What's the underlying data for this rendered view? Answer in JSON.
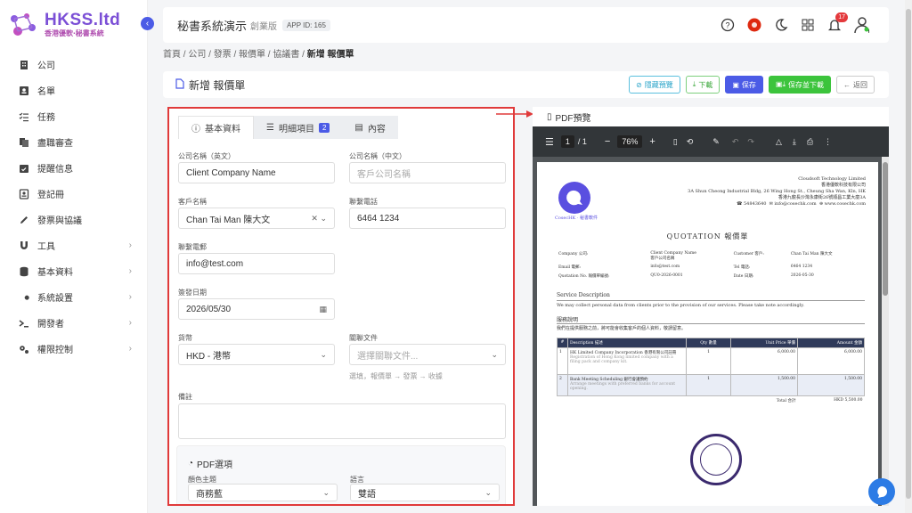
{
  "brand": {
    "title": "HKSS.ltd",
    "subtitle": "香港優軟‧秘書系統",
    "accent": "#7b4fd6"
  },
  "sidebar": {
    "items": [
      {
        "label": "公司",
        "icon": "building-icon"
      },
      {
        "label": "名單",
        "icon": "contact-card-icon"
      },
      {
        "label": "任務",
        "icon": "checklist-icon"
      },
      {
        "label": "盡職審查",
        "icon": "documents-icon"
      },
      {
        "label": "提醒信息",
        "icon": "calendar-check-icon"
      },
      {
        "label": "登記冊",
        "icon": "register-book-icon"
      },
      {
        "label": "發票與協議",
        "icon": "pen-icon"
      },
      {
        "label": "工具",
        "icon": "magnet-icon",
        "expandable": true
      },
      {
        "label": "基本資料",
        "icon": "database-icon",
        "expandable": true
      },
      {
        "label": "系統設置",
        "icon": "wrench-icon",
        "expandable": true
      },
      {
        "label": "開發者",
        "icon": "terminal-icon",
        "expandable": true
      },
      {
        "label": "權限控制",
        "icon": "gears-icon",
        "expandable": true
      }
    ]
  },
  "topbar": {
    "title": "秘書系統演示",
    "edition": "創業版",
    "app_id": "APP ID: 165",
    "notification_count": "17"
  },
  "breadcrumb": {
    "items": [
      "首頁",
      "公司",
      "發票 / 報價單 / 協議書"
    ],
    "current": "新增 報價單"
  },
  "page": {
    "title": "新增 報價單"
  },
  "actions": {
    "hide_preview": "隱藏預覽",
    "download": "下載",
    "save": "保存",
    "save_download": "保存並下載",
    "back": "返回"
  },
  "tabs": [
    {
      "label": "基本資料",
      "icon": "info-icon"
    },
    {
      "label": "明細項目",
      "icon": "list-icon",
      "count": "2"
    },
    {
      "label": "內容",
      "icon": "document-icon"
    }
  ],
  "form": {
    "company_en_label": "公司名稱（英文）",
    "company_en_value": "Client Company Name",
    "company_zh_label": "公司名稱（中文）",
    "company_zh_placeholder": "客戶公司名稱",
    "customer_label": "客戶名稱",
    "customer_value": "Chan Tai Man 陳大文",
    "phone_label": "聯繫電話",
    "phone_value": "6464 1234",
    "email_label": "聯繫電郵",
    "email_value": "info@test.com",
    "date_label": "簽發日期",
    "date_value": "2026/05/30",
    "currency_label": "貨幣",
    "currency_value": "HKD - 港幣",
    "related_label": "關聯文件",
    "related_placeholder": "選擇關聯文件...",
    "related_hint": "選填，報價單 → 發票 → 收據",
    "remark_label": "備註",
    "pdf_options_title": "PDF選項",
    "theme_label": "顏色主題",
    "theme_value": "商務藍",
    "language_label": "語言",
    "language_value": "雙語"
  },
  "pdf": {
    "label": "PDF預覽",
    "page": "1",
    "total_pages": "/ 1",
    "zoom": "76%",
    "company_en": "Cloudsoft Technology Limited",
    "company_zh": "香港優軟科技有限公司",
    "address_en": "3A Shun Cheong Industrial Bldg, 26 Wing Hong St., Cheung Sha Wan, Kln, HK",
    "address_zh": "香港九龍長沙灣永康街26號順昌工業大廈3A",
    "phone": "54843640",
    "email": "info@cosechk.com",
    "web": "www.cosechk.com",
    "logo_caption": "CosecHK · 秘書軟件",
    "doc_title": "QUOTATION 報價單",
    "info_rows": [
      [
        "Company 公司:",
        "Client Company Name\n客戶公司名稱",
        "Customer 客戶:",
        "Chan Tai Man 陳大文"
      ],
      [
        "Email 電郵:",
        "info@test.com",
        "Tel 電話:",
        "6464 1234"
      ],
      [
        "Quotation No. 報價單編號:",
        "QU0-2026-0001",
        "Date 日期:",
        "2026-05-30"
      ]
    ],
    "service_desc_title": "Service Description",
    "service_desc_text": "We may collect personal data from clients prior to the provision of our services. Please take note accordingly.",
    "service_desc_zh_title": "服務說明",
    "service_desc_zh_text": "我們在提供服務之前，將可能會收集客戶的個人資料，敬請留意。",
    "table_headers": [
      "#",
      "Description 描述",
      "Qty 數量",
      "Unit Price 單價",
      "Amount 金額"
    ],
    "rows": [
      {
        "no": "1",
        "desc": "HK Limited Company Incorporation 香港有限公司註冊",
        "sub": "Registration of Hong Kong limited company with a filing pack and company kit.",
        "qty": "1",
        "price": "6,000.00",
        "amount": "6,000.00"
      },
      {
        "no": "2",
        "desc": "Bank Meeting Scheduling 銀行會議預約",
        "sub": "Arrange meetings with preferred banks for account opening.",
        "qty": "1",
        "price": "1,500.00",
        "amount": "1,500.00"
      }
    ],
    "total_label": "Total 合計",
    "total_value": "HKD 5,500.00"
  }
}
